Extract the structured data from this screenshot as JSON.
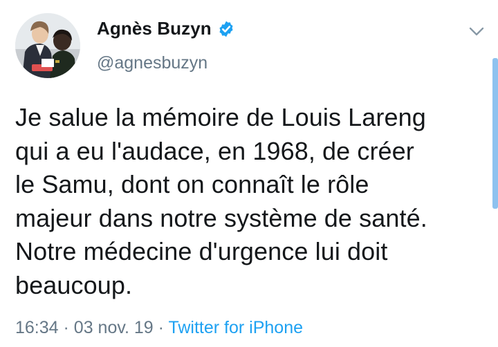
{
  "author": {
    "display_name": "Agnès Buzyn",
    "handle": "@agnesbuzyn",
    "verified": true
  },
  "tweet": {
    "text": "Je salue la mémoire de Louis Lareng\nqui a eu l'audace, en 1968, de créer\nle Samu, dont on connaît le rôle\nmajeur dans notre système de santé.\nNotre médecine d'urgence lui doit\nbeaucoup."
  },
  "meta": {
    "time": "16:34",
    "separator": "·",
    "date": "03 nov. 19",
    "source": "Twitter for iPhone"
  },
  "icons": {
    "verified": "verified-badge-icon",
    "menu": "chevron-down-icon"
  },
  "colors": {
    "link": "#1da1f2",
    "secondary_text": "#657786",
    "primary_text": "#14171a",
    "verified_badge": "#1da1f2"
  }
}
